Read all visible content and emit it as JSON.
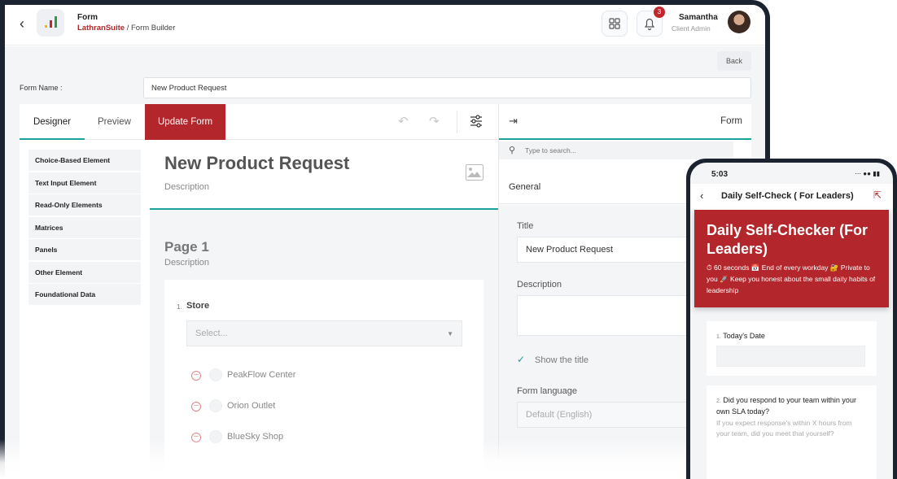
{
  "header": {
    "title": "Form",
    "brand": "LathranSuite",
    "breadcrumb_sep": " / ",
    "breadcrumb_page": "Form Builder",
    "notification_count": "3",
    "user_name": "Samantha",
    "user_role": "Client Admin"
  },
  "toolbar": {
    "back_label": "Back"
  },
  "form_name": {
    "label": "Form Name :",
    "value": "New Product Request"
  },
  "tabs": {
    "designer": "Designer",
    "preview": "Preview",
    "update": "Update Form"
  },
  "toolbox": [
    "Choice-Based Element",
    "Text Input Element",
    "Read-Only Elements",
    "Matrices",
    "Panels",
    "Other Element",
    "Foundational Data"
  ],
  "canvas": {
    "title": "New Product Request",
    "description": "Description",
    "page_title": "Page 1",
    "page_description": "Description",
    "question": {
      "number": "1.",
      "title": "Store",
      "placeholder": "Select...",
      "options": [
        "PeakFlow Center",
        "Orion Outlet",
        "BlueSky Shop"
      ]
    }
  },
  "properties": {
    "tab": "Form",
    "search_placeholder": "Type to search...",
    "section": "General",
    "title_label": "Title",
    "title_value": "New Product Request",
    "description_label": "Description",
    "show_title_label": "Show the title",
    "language_label": "Form language",
    "language_value": "Default (English)"
  },
  "phone": {
    "time": "5:03",
    "header_title": "Daily Self-Check ( For Leaders)",
    "banner_title": "Daily Self-Checker (For Leaders)",
    "banner_sub": "⏱ 60 seconds 📅 End of every workday 🔐 Private to you 🚀 Keep you honest about the small daily habits of leadership",
    "q1_number": "1.",
    "q1_title": "Today's Date",
    "q2_number": "2.",
    "q2_title": "Did you respond to your team within your own SLA today?",
    "q2_hint": "If you expect response's within X hours from your team, did you meet that yourself?"
  },
  "colors": {
    "brand": "#b3262b",
    "accent": "#1aa39a"
  }
}
